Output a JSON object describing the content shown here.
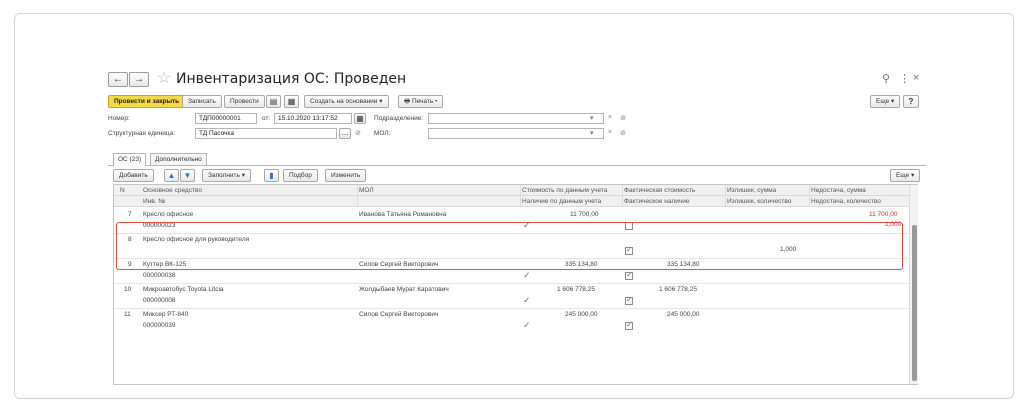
{
  "window": {
    "title": "Инвентаризация ОС: Проведен"
  },
  "toolbar": {
    "post_close": "Провести и закрыть",
    "save": "Записать",
    "post": "Провести",
    "create_based": "Создать на основании",
    "print": "Печать",
    "more": "Еще",
    "help": "?"
  },
  "form": {
    "number_label": "Номер:",
    "number_value": "ТДП00000001",
    "date_label": "от:",
    "date_value": "15.10.2020 13:17:52",
    "department_label": "Подразделение:",
    "department_value": "",
    "unit_label": "Структурная единица:",
    "unit_value": "ТД Пасочка",
    "mol_label": "МОЛ:",
    "mol_value": ""
  },
  "tabs": [
    {
      "label": "ОС (23)"
    },
    {
      "label": "Дополнительно"
    }
  ],
  "table_toolbar": {
    "add": "Добавить",
    "fill": "Заполнить",
    "select": "Подбор",
    "change": "Изменить",
    "more": "Еще"
  },
  "table": {
    "headers_top": [
      "N",
      "Основное средство",
      "МОЛ",
      "Стоимость по данным учета",
      "Фактическая стоимость",
      "Излишек, сумма",
      "Недостача, сумма"
    ],
    "headers_bottom": [
      "Инв. №",
      "Наличие по данным учета",
      "Фактическое наличие",
      "Излишек, количество",
      "Недостача, количество"
    ],
    "rows": [
      {
        "n": "7",
        "asset": "Кресло офисное",
        "inv": "000000023",
        "mol": "Иванова Татьяна Романовна",
        "cost": "11 700,00",
        "fact_cost": "",
        "surplus_sum": "",
        "shortage_sum": "11 700,00",
        "surplus_qty": "",
        "shortage_qty": "1,000",
        "has_book": true,
        "has_fact": false
      },
      {
        "n": "8",
        "asset": "Кресло офисное для руководителя",
        "inv": "",
        "mol": "",
        "cost": "",
        "fact_cost": "",
        "surplus_sum": "",
        "shortage_sum": "",
        "surplus_qty": "1,000",
        "shortage_qty": "",
        "has_book": false,
        "has_fact": true
      },
      {
        "n": "9",
        "asset": "Куттер ВК-125",
        "inv": "000000038",
        "mol": "Силов Сергей Викторович",
        "cost": "335 134,80",
        "fact_cost": "335 134,80",
        "surplus_sum": "",
        "shortage_sum": "",
        "surplus_qty": "",
        "shortage_qty": "",
        "has_book": true,
        "has_fact": true
      },
      {
        "n": "10",
        "asset": "Микроавтобус Toyota Litcia",
        "inv": "000000008",
        "mol": "Жолдыбаев Мурат Каратович",
        "cost": "1 606 778,25",
        "fact_cost": "1 606 778,25",
        "surplus_sum": "",
        "shortage_sum": "",
        "surplus_qty": "",
        "shortage_qty": "",
        "has_book": true,
        "has_fact": true
      },
      {
        "n": "11",
        "asset": "Миксер РТ-840",
        "inv": "000000039",
        "mol": "Силов Сергей Викторович",
        "cost": "245 000,00",
        "fact_cost": "245 000,00",
        "surplus_sum": "",
        "shortage_sum": "",
        "surplus_qty": "",
        "shortage_qty": "",
        "has_book": true,
        "has_fact": true
      }
    ]
  },
  "colors": {
    "primary_button": "#f2d84a",
    "highlight": "#e0524a",
    "shortage_text": "#d62c1a",
    "check": "#3a9a3a"
  }
}
